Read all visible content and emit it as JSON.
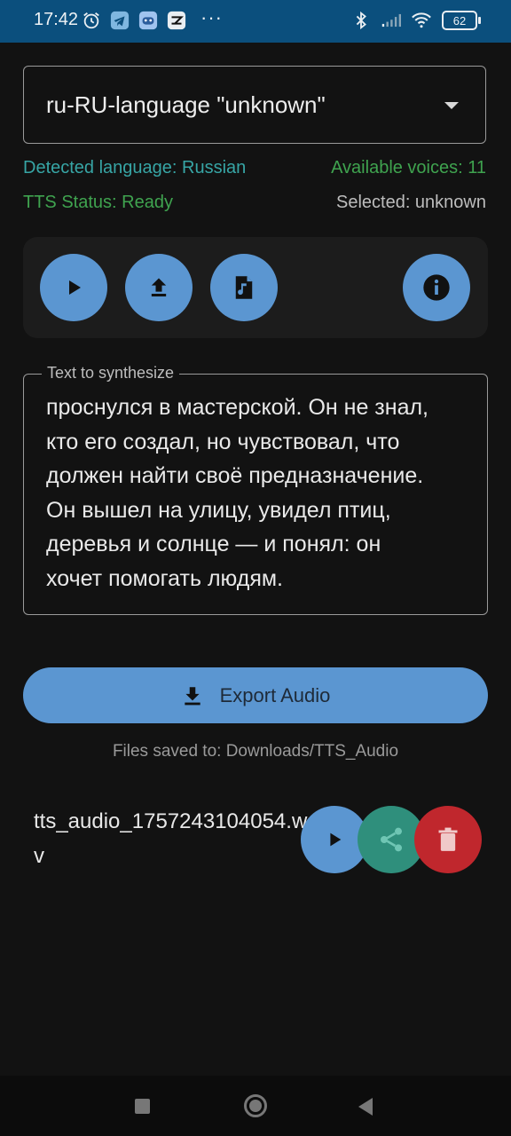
{
  "status_bar": {
    "time": "17:42",
    "battery": "62",
    "icons_left": [
      "alarm-icon",
      "telegram-icon",
      "gamepad-icon",
      "capcut-icon"
    ],
    "icons_right": [
      "bluetooth-icon",
      "signal-icon",
      "wifi-icon",
      "battery-icon"
    ],
    "more": "···"
  },
  "language_select": {
    "value": "ru-RU-language \"unknown\""
  },
  "info": {
    "detected_language": "Detected language: Russian",
    "available_voices": "Available voices: 11",
    "tts_status": "TTS Status: Ready",
    "selected": "Selected: unknown"
  },
  "toolbar": {
    "buttons": [
      "play-icon",
      "upload-icon",
      "audio-file-icon",
      "info-icon"
    ]
  },
  "text_field": {
    "label": "Text to synthesize",
    "value": "проснулся в мастерской. Он не знал,\nкто его создал, но чувствовал, что\nдолжен найти своё предназначение.\nОн вышел на улицу, увидел птиц,\nдеревья и солнце — и понял: он\nхочет помогать людям."
  },
  "export": {
    "label": "Export Audio",
    "saved_to": "Files saved to: Downloads/TTS_Audio"
  },
  "files": [
    {
      "name": "tts_audio_1757243104054.wav"
    }
  ],
  "colors": {
    "accent": "#5b96d1",
    "share": "#2f8f7c",
    "delete": "#c0272d",
    "status_bar": "#0b4f7d",
    "detected_language": "#37a5a5",
    "ready": "#3fa34f"
  }
}
